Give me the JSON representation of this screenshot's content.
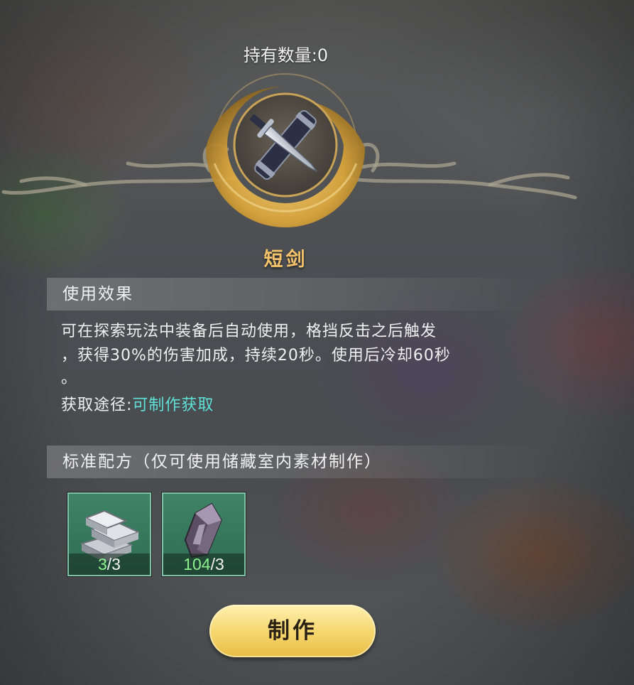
{
  "owned_quantity_text": "持有数量:0",
  "item": {
    "name": "短剑",
    "icon": "short-sword-icon"
  },
  "effect_section": {
    "title": "使用效果",
    "description_lines": [
      "可在探索玩法中装备后自动使用，格挡反击之后触发",
      "，获得30%的伤害加成，持续20秒。使用后冷却60秒",
      "。"
    ],
    "source_label": "获取途径:",
    "source_link": "可制作获取"
  },
  "recipe_section": {
    "title": "标准配方（仅可使用储藏室内素材制作）",
    "materials": [
      {
        "icon": "iron-ingot-icon",
        "have": "3",
        "need": "/3"
      },
      {
        "icon": "dark-crystal-icon",
        "have": "104",
        "need": "/3"
      }
    ]
  },
  "craft_button_label": "制作",
  "colors": {
    "item_name": "#f4c26a",
    "source_link": "#5fe0d8",
    "have_count": "#8ff08f",
    "material_bg": "#3f8466",
    "button_gold": "#f5d56c"
  }
}
